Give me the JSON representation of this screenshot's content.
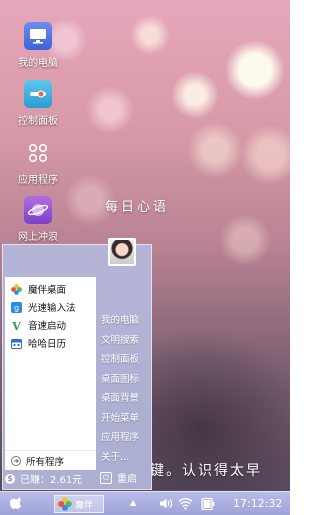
{
  "desktop": {
    "icons": [
      {
        "label": "我的电脑",
        "icon": "monitor-icon"
      },
      {
        "label": "控制面板",
        "icon": "control-panel-icon"
      },
      {
        "label": "应用程序",
        "icon": "apps-icon"
      },
      {
        "label": "网上冲浪",
        "icon": "planet-icon"
      }
    ],
    "quote_top": "每日心语",
    "quote_bottom": "键。认识得太早"
  },
  "start_menu": {
    "programs": [
      {
        "label": "魔伴桌面",
        "icon": "flower-icon"
      },
      {
        "label": "光速输入法",
        "icon": "g-keyboard-icon"
      },
      {
        "label": "音速启动",
        "icon": "v-launcher-icon"
      },
      {
        "label": "哈哈日历",
        "icon": "calendar-icon"
      }
    ],
    "all_programs": "所有程序",
    "right_items": [
      "我的电脑",
      "文明搜索",
      "控制面板",
      "桌面图标",
      "桌面背景",
      "开始菜单",
      "应用程序",
      "关于..."
    ],
    "earned": "已赚：2.61元",
    "restart": "重启"
  },
  "taskbar": {
    "app_label": "魔伴",
    "clock": "17:12:32"
  },
  "colors": {
    "menu_bg": "#b4b9dc",
    "taskbar": "#a9ade0"
  }
}
